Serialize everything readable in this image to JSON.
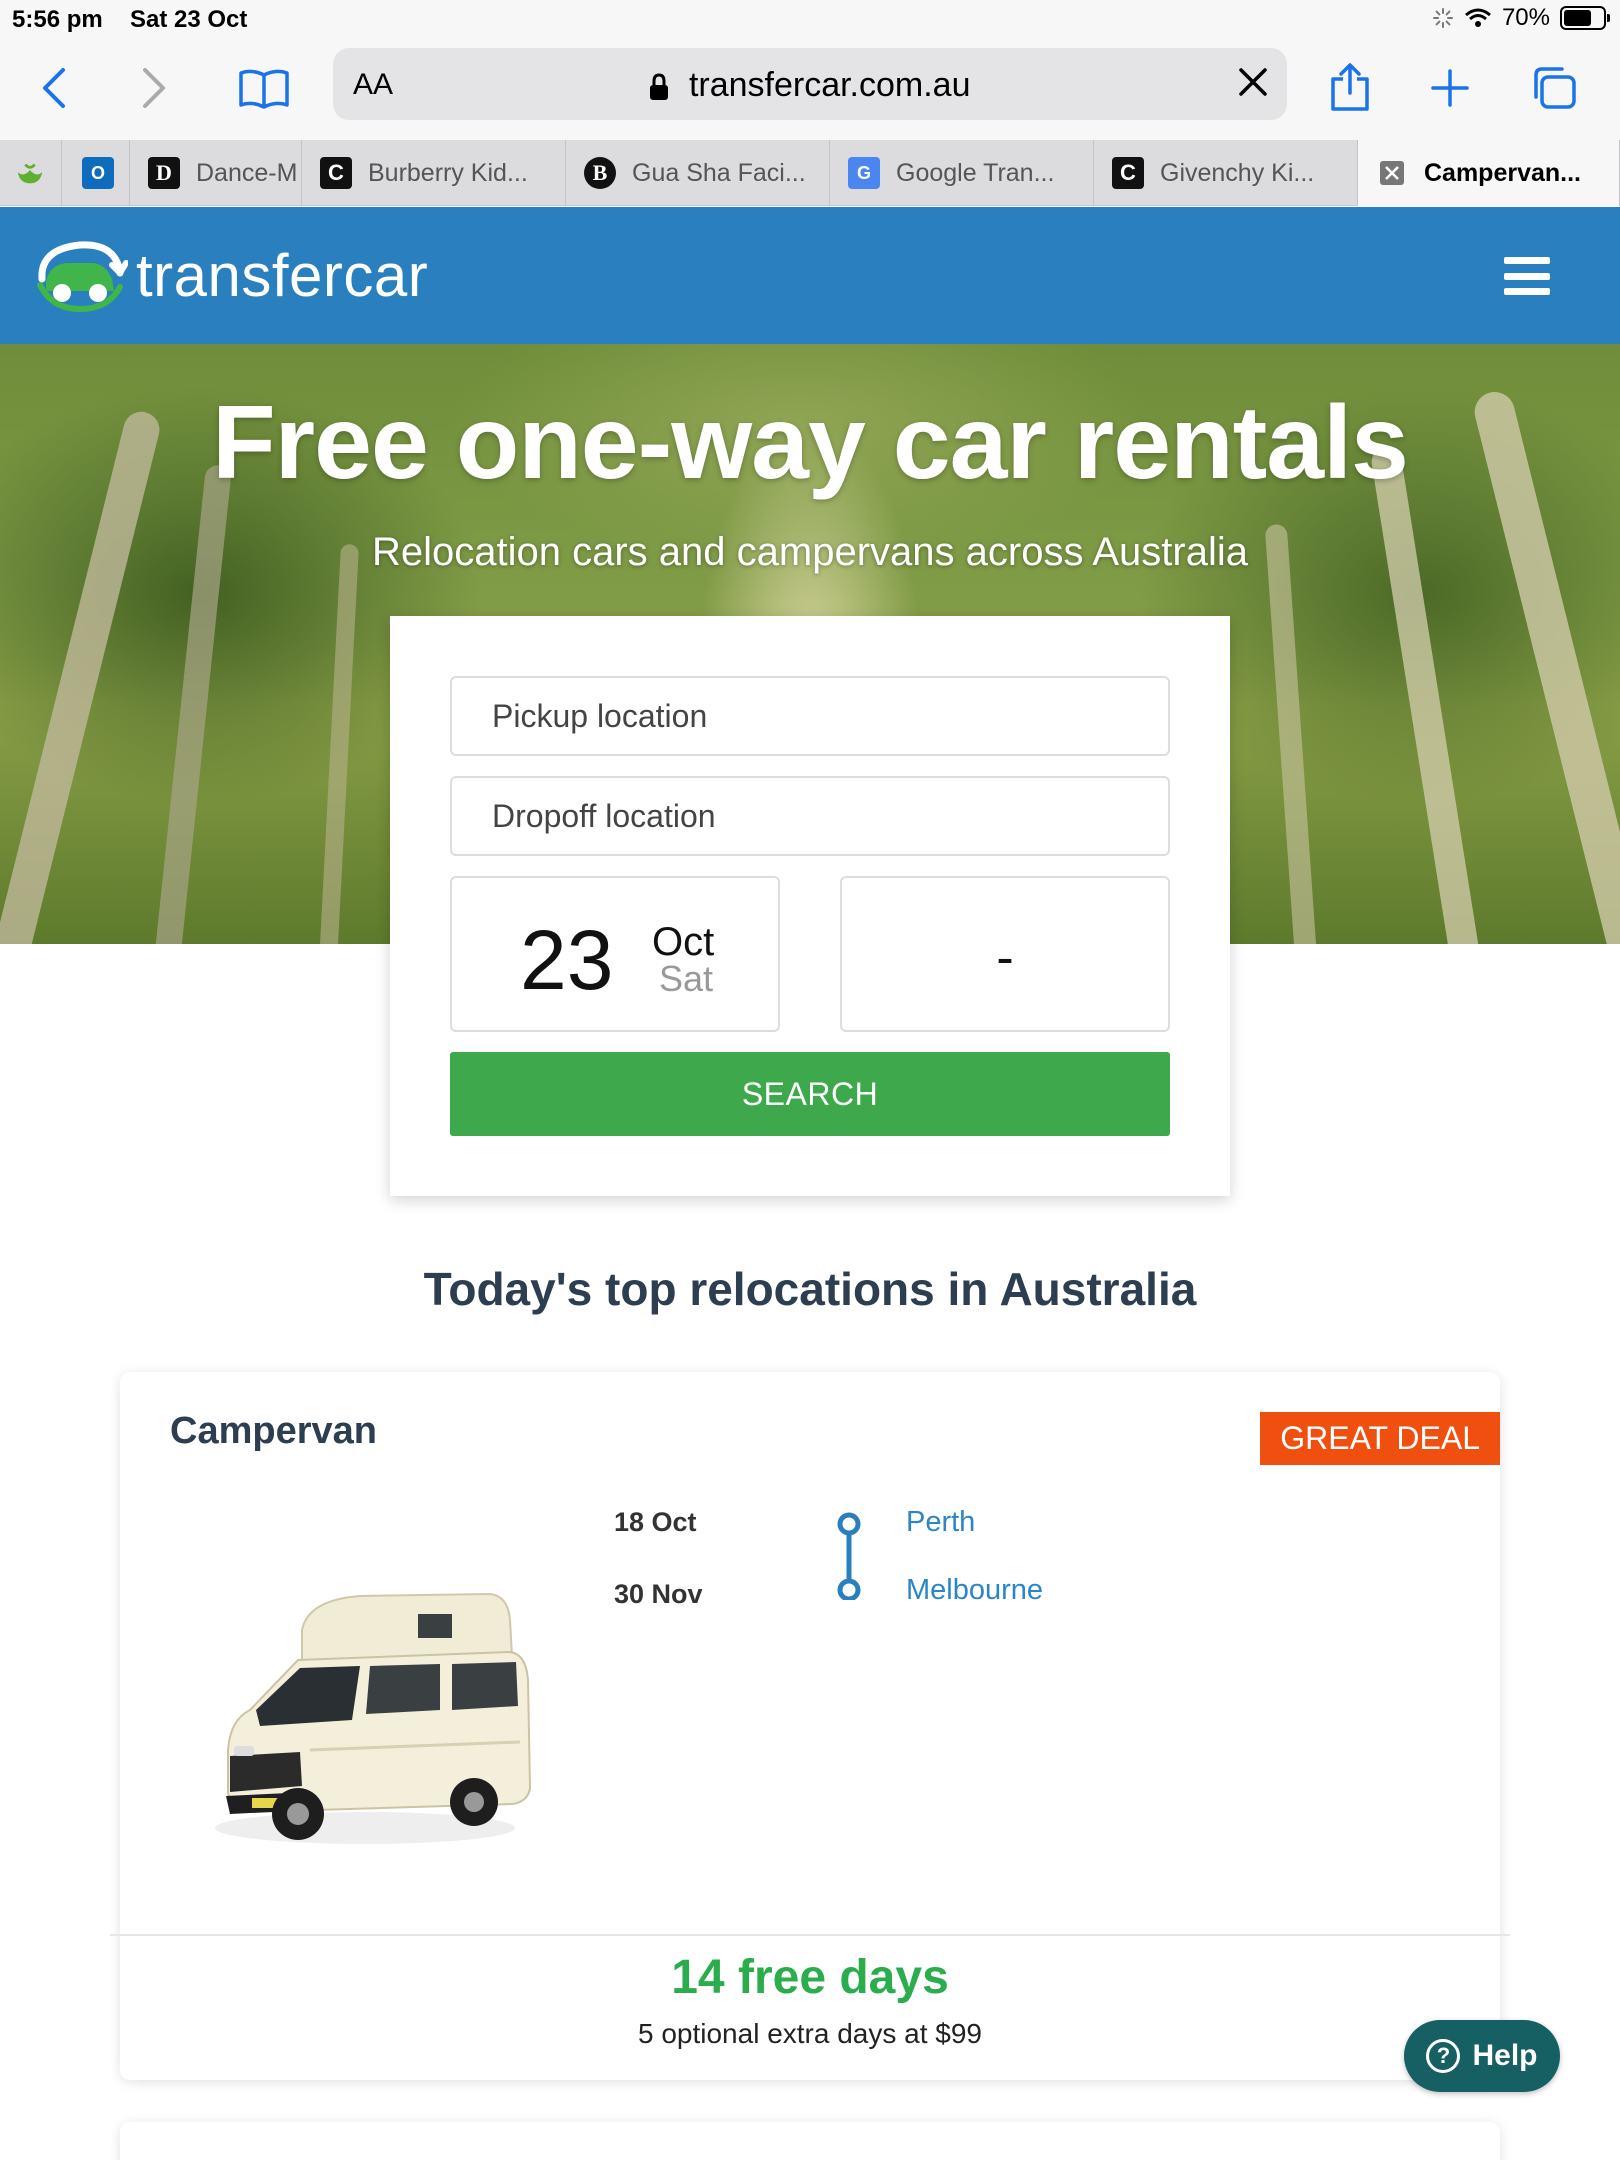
{
  "status_bar": {
    "time": "5:56 pm",
    "date": "Sat 23 Oct",
    "battery": "70%",
    "battery_level": 0.7
  },
  "browser": {
    "address_prefix": "AA",
    "url": "transfercar.com.au",
    "tabs": [
      {
        "label": "",
        "icon": "woolworths-icon"
      },
      {
        "label": "",
        "icon": "outlook-icon"
      },
      {
        "label": "Dance-M",
        "icon": "d-logo-icon"
      },
      {
        "label": "Burberry Kid...",
        "icon": "c-logo-icon"
      },
      {
        "label": "Gua Sha Faci...",
        "icon": "b-logo-icon"
      },
      {
        "label": "Google Tran...",
        "icon": "google-translate-icon"
      },
      {
        "label": "Givenchy Ki...",
        "icon": "c-logo-icon"
      },
      {
        "label": "Campervan...",
        "icon": "close-icon"
      }
    ]
  },
  "site": {
    "logo_text": "transfercar",
    "hero_title": "Free one-way car rentals",
    "hero_subtitle": "Relocation cars and campervans across Australia",
    "search": {
      "pickup_placeholder": "Pickup location",
      "dropoff_placeholder": "Dropoff location",
      "start_day": "23",
      "start_month": "Oct",
      "start_weekday": "Sat",
      "end_date": "-",
      "button_label": "SEARCH"
    },
    "section_title": "Today's top relocations in Australia",
    "deal": {
      "vehicle_type": "Campervan",
      "badge": "GREAT DEAL",
      "from_date": "18 Oct",
      "to_date": "30 Nov",
      "from_city": "Perth",
      "to_city": "Melbourne",
      "free_days": "14 free days",
      "extra_days": "5 optional extra days at $99"
    },
    "help_label": "Help"
  },
  "colors": {
    "brand_blue": "#2a7fbe",
    "search_green": "#3ea94c",
    "deal_orange": "#f0500f",
    "free_days_green": "#2bad4e",
    "link_blue": "#2a86c8",
    "help_teal": "#165f62"
  }
}
